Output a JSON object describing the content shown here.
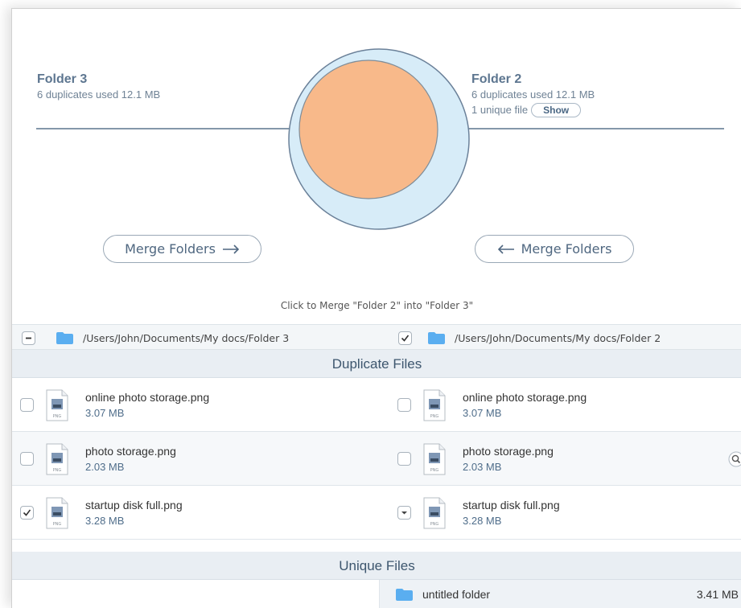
{
  "left_folder": {
    "name": "Folder 3",
    "duplicates": "6 duplicates used 12.1 MB",
    "path": "/Users/John/Documents/My docs/Folder 3",
    "merge_label": "Merge Folders"
  },
  "right_folder": {
    "name": "Folder 2",
    "duplicates": "6 duplicates used 12.1 MB",
    "unique": "1 unique file",
    "show_label": "Show",
    "path": "/Users/John/Documents/My docs/Folder 2",
    "merge_label": "Merge Folders"
  },
  "hint": "Click to Merge \"Folder 2\" into \"Folder 3\"",
  "sections": {
    "duplicate": "Duplicate Files",
    "unique": "Unique Files"
  },
  "duplicate_files": [
    {
      "left": {
        "name": "online photo storage.png",
        "size": "3.07 MB",
        "checked": false
      },
      "right": {
        "name": "online photo storage.png",
        "size": "3.07 MB",
        "checked": false
      }
    },
    {
      "left": {
        "name": "photo storage.png",
        "size": "2.03 MB",
        "checked": false
      },
      "right": {
        "name": "photo storage.png",
        "size": "2.03 MB",
        "checked": false
      }
    },
    {
      "left": {
        "name": "startup disk full.png",
        "size": "3.28 MB",
        "checked": true
      },
      "right": {
        "name": "startup disk full.png",
        "size": "3.28 MB",
        "checked": false
      }
    }
  ],
  "unique_files": [
    {
      "name": "untitled folder",
      "size": "3.41 MB"
    }
  ],
  "icons": {
    "folder": "folder-icon",
    "file": "png-file-icon",
    "zoom": "magnifier-icon"
  },
  "colors": {
    "venn_orange": "#f8b98a",
    "venn_blue": "#d7ecf8",
    "folder_blue": "#5aaef0",
    "accent_text": "#5d7690"
  }
}
